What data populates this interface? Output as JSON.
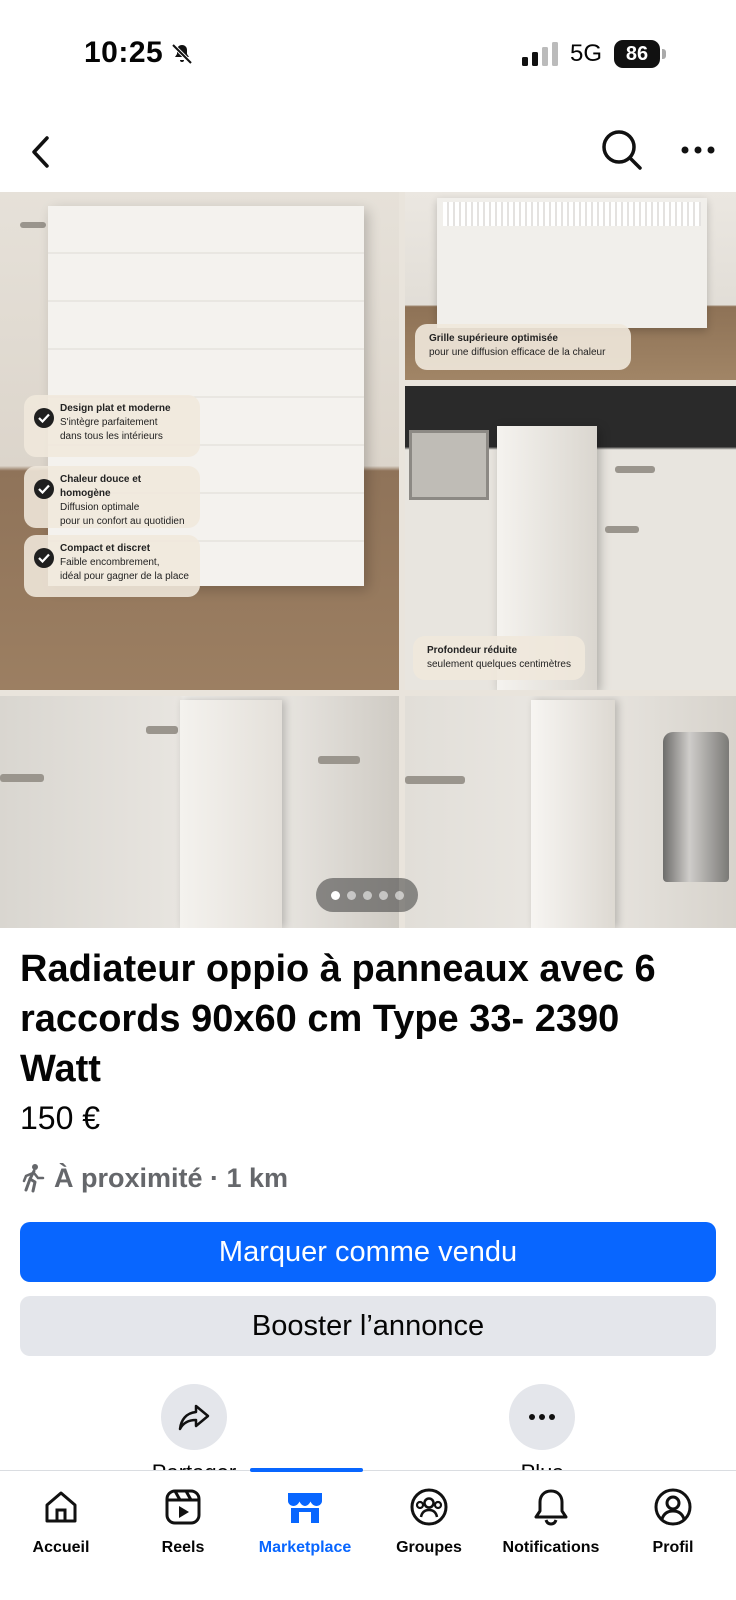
{
  "status_bar": {
    "time": "10:25",
    "network": "5G",
    "battery": "86"
  },
  "gallery": {
    "feature_cards": [
      {
        "title": "Design plat et moderne",
        "line1": "S'intègre parfaitement",
        "line2": "dans tous les intérieurs"
      },
      {
        "title": "Chaleur douce et homogène",
        "line1": "Diffusion optimale",
        "line2": "pour un confort au quotidien"
      },
      {
        "title": "Compact et discret",
        "line1": "Faible encombrement,",
        "line2": "idéal pour gagner de la place"
      }
    ],
    "note_top": {
      "title": "Grille supérieure optimisée",
      "body": "pour une diffusion efficace de la chaleur"
    },
    "note_depth": {
      "title": "Profondeur réduite",
      "body": "seulement quelques centimètres"
    },
    "page_count": 5,
    "active_page": 1
  },
  "listing": {
    "title": "Radiateur oppio à panneaux avec 6 raccords 90x60 cm Type 33- 2390 Watt",
    "price": "150 €",
    "location": "À proximité · 1 km"
  },
  "buttons": {
    "mark_sold": "Marquer comme vendu",
    "boost": "Booster l’annonce"
  },
  "actions": {
    "share": "Partager",
    "more": "Plus"
  },
  "bottom_nav": {
    "items": [
      {
        "label": "Accueil",
        "icon": "home-icon"
      },
      {
        "label": "Reels",
        "icon": "reels-icon"
      },
      {
        "label": "Marketplace",
        "icon": "marketplace-icon"
      },
      {
        "label": "Groupes",
        "icon": "groups-icon"
      },
      {
        "label": "Notifications",
        "icon": "bell-icon"
      },
      {
        "label": "Profil",
        "icon": "profile-icon"
      }
    ],
    "active": "Marketplace"
  },
  "colors": {
    "accent": "#0866ff",
    "secondary_button": "#e4e6eb",
    "muted_text": "#65676b"
  }
}
